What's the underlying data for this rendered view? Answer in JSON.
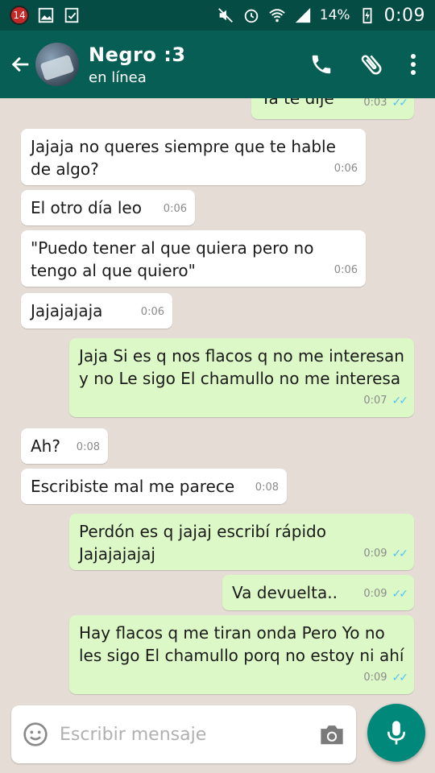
{
  "status_bar": {
    "notification_count": "14",
    "battery": "14%",
    "time": "0:09"
  },
  "header": {
    "contact_name": "Negro :3",
    "contact_status": "en línea"
  },
  "messages": [
    {
      "text": "Ya te dije",
      "time": "0:03",
      "dir": "out"
    },
    {
      "text": "Jajaja no queres siempre que te hable de algo?",
      "time": "0:06",
      "dir": "in"
    },
    {
      "text": "El otro día leo",
      "time": "0:06",
      "dir": "in"
    },
    {
      "text": "\"Puedo tener al que quiera pero no tengo al que quiero\"",
      "time": "0:06",
      "dir": "in"
    },
    {
      "text": "Jajajajaja",
      "time": "0:06",
      "dir": "in"
    },
    {
      "text": "Jaja Si es q nos flacos q no me interesan y no Le sigo El chamullo no me interesa",
      "time": "0:07",
      "dir": "out"
    },
    {
      "text": "Ah?",
      "time": "0:08",
      "dir": "in"
    },
    {
      "text": "Escribiste mal me parece",
      "time": "0:08",
      "dir": "in"
    },
    {
      "text": "Perdón es q jajaj escribí rápido Jajajajajaj",
      "time": "0:09",
      "dir": "out"
    },
    {
      "text": "Va devuelta..",
      "time": "0:09",
      "dir": "out"
    },
    {
      "text": "Hay flacos q me tiran onda Pero Yo no les sigo El chamullo porq no estoy ni ahí",
      "time": "0:09",
      "dir": "out"
    }
  ],
  "composer": {
    "placeholder": "Escribir mensaje"
  },
  "icons": [
    "back-arrow-icon",
    "phone-icon",
    "attach-icon",
    "more-vert-icon",
    "emoji-icon",
    "camera-icon",
    "mic-icon"
  ],
  "colors": {
    "header": "#075e54",
    "outgoing": "#dcf8c6",
    "incoming": "#ffffff",
    "accent": "#00897b"
  }
}
